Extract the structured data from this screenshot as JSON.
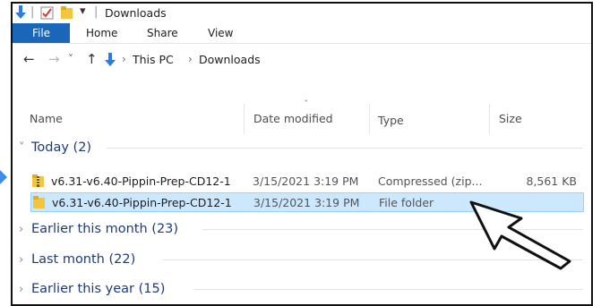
{
  "titlebar": {
    "title": "Downloads",
    "qat_separator": "|",
    "qat_dropdown": "▾"
  },
  "ribbon": {
    "tabs": [
      {
        "label": "File",
        "active": true
      },
      {
        "label": "Home"
      },
      {
        "label": "Share"
      },
      {
        "label": "View"
      }
    ],
    "accent": "#1a66b8"
  },
  "address": {
    "back": "←",
    "forward": "→",
    "recent": "˅",
    "up": "↑",
    "crumbs": [
      "This PC",
      "Downloads"
    ],
    "crumb_sep": "›"
  },
  "columns": {
    "name": "Name",
    "date": "Date modified",
    "type": "Type",
    "size": "Size",
    "sort_indicator": "ˇ"
  },
  "groups": [
    {
      "label": "Today (2)",
      "expanded": true,
      "chevron": "˅",
      "items": [
        {
          "name": "v6.31-v6.40-Pippin-Prep-CD12-1",
          "date": "3/15/2021 3:19 PM",
          "type": "Compressed (zip...",
          "size": "8,561 KB",
          "icon": "zip-folder-icon",
          "selected": false
        },
        {
          "name": "v6.31-v6.40-Pippin-Prep-CD12-1",
          "date": "3/15/2021 3:19 PM",
          "type": "File folder",
          "size": "",
          "icon": "folder-icon",
          "selected": true
        }
      ]
    },
    {
      "label": "Earlier this month (23)",
      "expanded": false,
      "chevron": "›"
    },
    {
      "label": "Last month (22)",
      "expanded": false,
      "chevron": "›"
    },
    {
      "label": "Earlier this year (15)",
      "expanded": false,
      "chevron": "›"
    }
  ],
  "colors": {
    "selection_bg": "#cce8ff",
    "selection_border": "#99d1ff",
    "group_text": "#1e3c78",
    "folder_yellow": "#f2c53d"
  }
}
